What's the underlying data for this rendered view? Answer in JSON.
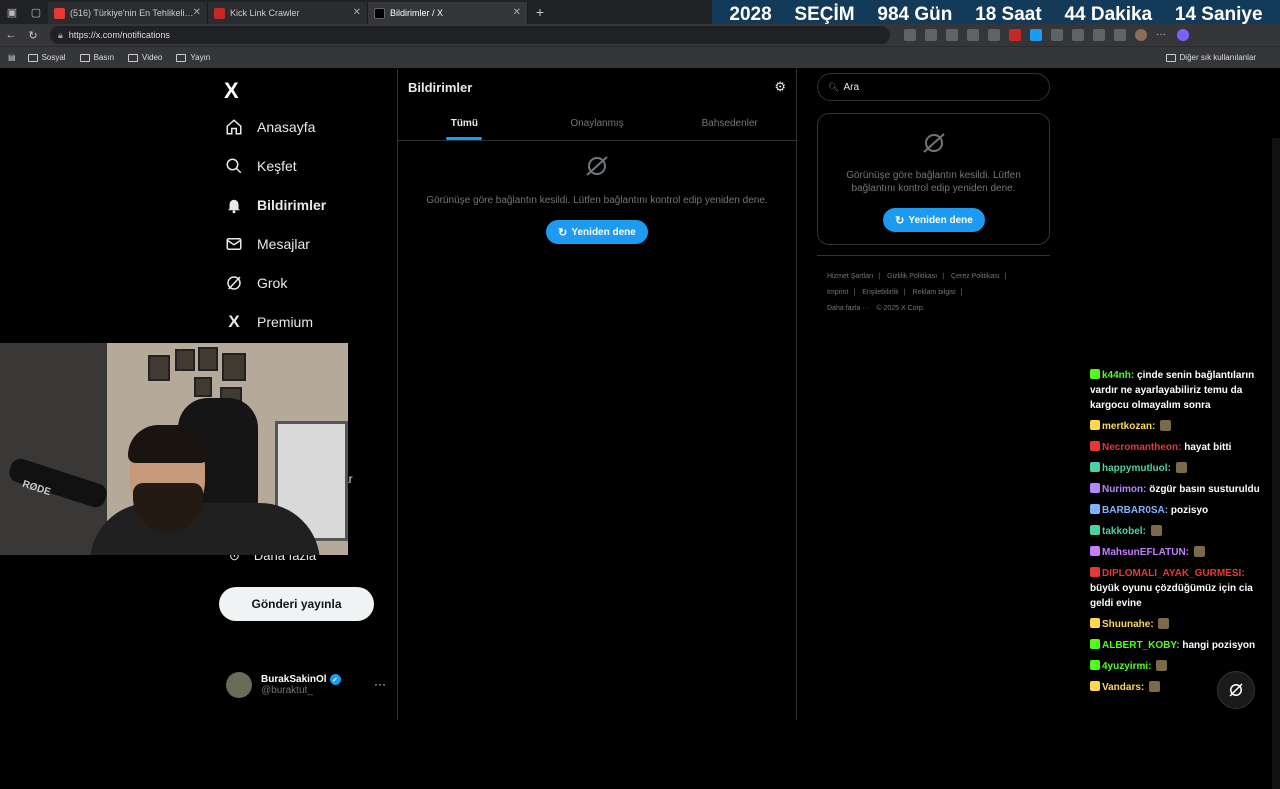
{
  "browser": {
    "tabs": [
      {
        "label": "(516) Türkiye'nin En Tehlikeli Mah",
        "fav_color": "#e53935",
        "active": false
      },
      {
        "label": "Kick Link Crawler",
        "fav_color": "#c62828",
        "active": false
      },
      {
        "label": "Bildirimler / X",
        "fav_color": "#000000",
        "active": true
      }
    ],
    "url": "https://x.com/notifications",
    "bookmarks": [
      "Sosyal",
      "Basın",
      "Video",
      "Yayın"
    ],
    "bookmarks_right": "Diğer sık kullanılanlar"
  },
  "countdown": {
    "year": "2028",
    "label": "SEÇİM",
    "days": "984 Gün",
    "hours": "18 Saat",
    "minutes": "44 Dakika",
    "seconds": "14 Saniye"
  },
  "sidebar": {
    "logo": "X",
    "items": [
      {
        "label": "Anasayfa",
        "icon": "home-icon"
      },
      {
        "label": "Keşfet",
        "icon": "search-icon"
      },
      {
        "label": "Bildirimler",
        "icon": "bell-icon"
      },
      {
        "label": "Mesajlar",
        "icon": "mail-icon"
      },
      {
        "label": "Grok",
        "icon": "grok-icon"
      },
      {
        "label": "Premium",
        "icon": "x-icon"
      }
    ],
    "partial_item": "ar",
    "more_label": "Daha fazla",
    "post_button": "Gönderi yayınla",
    "profile": {
      "name": "BurakSakinOl",
      "handle": "@buraktut_"
    }
  },
  "main": {
    "title": "Bildirimler",
    "tabs": [
      "Tümü",
      "Onaylanmış",
      "Bahsedenler"
    ],
    "error_text": "Görünüşe göre bağlantın kesildi. Lütfen bağlantını kontrol edip yeniden dene.",
    "retry_label": "Yeniden dene"
  },
  "right": {
    "search_placeholder": "Ara",
    "card_error": "Görünüşe göre bağlantın kesildi. Lütfen bağlantını kontrol edip yeniden dene.",
    "retry_label": "Yeniden dene",
    "footer": {
      "links": [
        "Hizmet Şartları",
        "Gizlilik Politikası",
        "Çerez Politikası",
        "Imprint",
        "Erişilebilirlik",
        "Reklam bilgisi",
        "Daha fazla ···"
      ],
      "copyright": "© 2025 X Corp."
    }
  },
  "webcam": {
    "mic_brand": "RØDE"
  },
  "chat": [
    {
      "user": "k44nh",
      "color": "#53fc18",
      "msg": "çinde senin bağlantıların vardır ne ayarlayabiliriz temu da kargocu olmayalım sonra"
    },
    {
      "user": "mertkozan",
      "color": "#ffd84d",
      "msg": ""
    },
    {
      "user": "Necromantheon",
      "color": "#e53935",
      "msg": "hayat bitti"
    },
    {
      "user": "happymutluol",
      "color": "#4dd0a8",
      "msg": ""
    },
    {
      "user": "Nurimon",
      "color": "#b388ff",
      "msg": "özgür basın susturuldu"
    },
    {
      "user": "BARBAR0SA",
      "color": "#7fb3ff",
      "msg": "pozisyo"
    },
    {
      "user": "takkobel",
      "color": "#4dd0a8",
      "msg": ""
    },
    {
      "user": "MahsunEFLATUN",
      "color": "#c77dff",
      "msg": ""
    },
    {
      "user": "DIPLOMALI_AYAK_GURMESI",
      "color": "#e53935",
      "msg": "büyük oyunu çözdüğümüz için cia geldi evine"
    },
    {
      "user": "Shuunahe",
      "color": "#ffd84d",
      "msg": ""
    },
    {
      "user": "ALBERT_KOBY",
      "color": "#53fc18",
      "msg": "hangi pozisyon"
    },
    {
      "user": "4yuzyirmi",
      "color": "#53fc18",
      "msg": ""
    },
    {
      "user": "Vandars",
      "color": "#ffd84d",
      "msg": ""
    }
  ]
}
